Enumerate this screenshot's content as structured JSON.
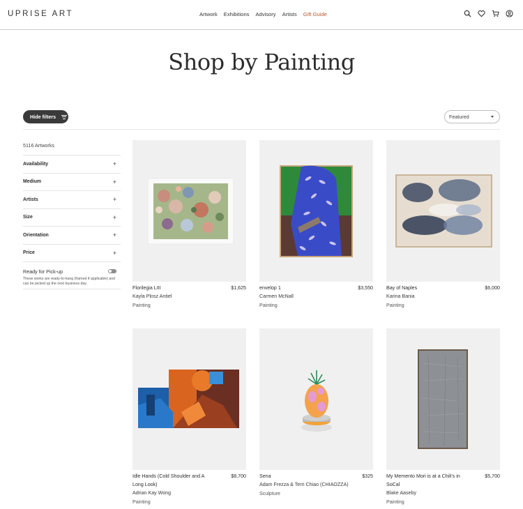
{
  "header": {
    "logo": "UPRISE ART",
    "nav": [
      "Artwork",
      "Exhibitions",
      "Advisory",
      "Artists",
      "Gift Guide"
    ]
  },
  "page": {
    "title": "Shop by Painting"
  },
  "toolbar": {
    "hide_filters": "Hide filters",
    "sort": "Featured"
  },
  "sidebar": {
    "count": "5116 Artworks",
    "facets": [
      "Availability",
      "Medium",
      "Artists",
      "Size",
      "Orientation",
      "Price"
    ],
    "pickup_label": "Ready for Pick-up",
    "pickup_desc": "These works are ready-to-hang (framed if applicable) and can be picked up the next business day."
  },
  "products": [
    {
      "title": "Florilegia LIII",
      "price": "$1,625",
      "artist": "Kayla Plosz Antiel",
      "medium": "Painting"
    },
    {
      "title": "envelop 1",
      "price": "$3,550",
      "artist": "Carmen McNall",
      "medium": "Painting"
    },
    {
      "title": "Bay of Naples",
      "price": "$6,000",
      "artist": "Karina Bania",
      "medium": "Painting"
    },
    {
      "title": "Idle Hands (Cold Shoulder and A Long Look)",
      "price": "$8,700",
      "artist": "Adrian Kay Wong",
      "medium": "Painting"
    },
    {
      "title": "Sena",
      "price": "$325",
      "artist": "Adam Frezza & Terri Chiao (CHIAOZZA)",
      "medium": "Sculpture"
    },
    {
      "title": "My Memento Mori is at a Chili's in SoCal",
      "price": "$5,700",
      "artist": "Blake Aaseby",
      "medium": "Painting"
    }
  ]
}
